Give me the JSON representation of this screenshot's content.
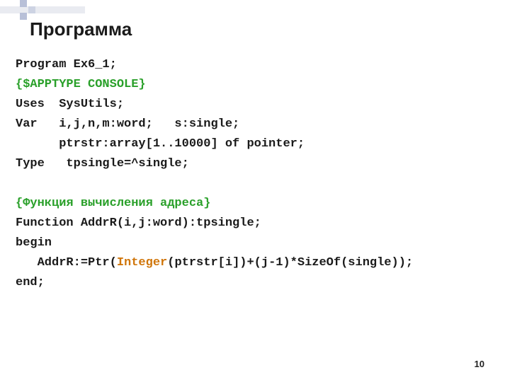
{
  "slide": {
    "title": "Программа",
    "page_number": "10"
  },
  "code": {
    "l1": "Program Ex6_1;",
    "l2": "{$APPTYPE CONSOLE}",
    "l3a": "Uses  SysUtils;",
    "l4": "Var   i,j,n,m:word;   s:single;",
    "l5": "      ptrstr:array[1..10000] of pointer;",
    "l6": "Type   tpsingle=^single;",
    "l7": "",
    "l8": "{Функция вычисления адреса}",
    "l9": "Function AddrR(i,j:word):tpsingle;",
    "l10": "begin",
    "l11a": "   AddrR:=Ptr(",
    "l11b": "Integer",
    "l11c": "(ptrstr[i])+(j-1)*SizeOf(single));",
    "l12": "end;"
  }
}
